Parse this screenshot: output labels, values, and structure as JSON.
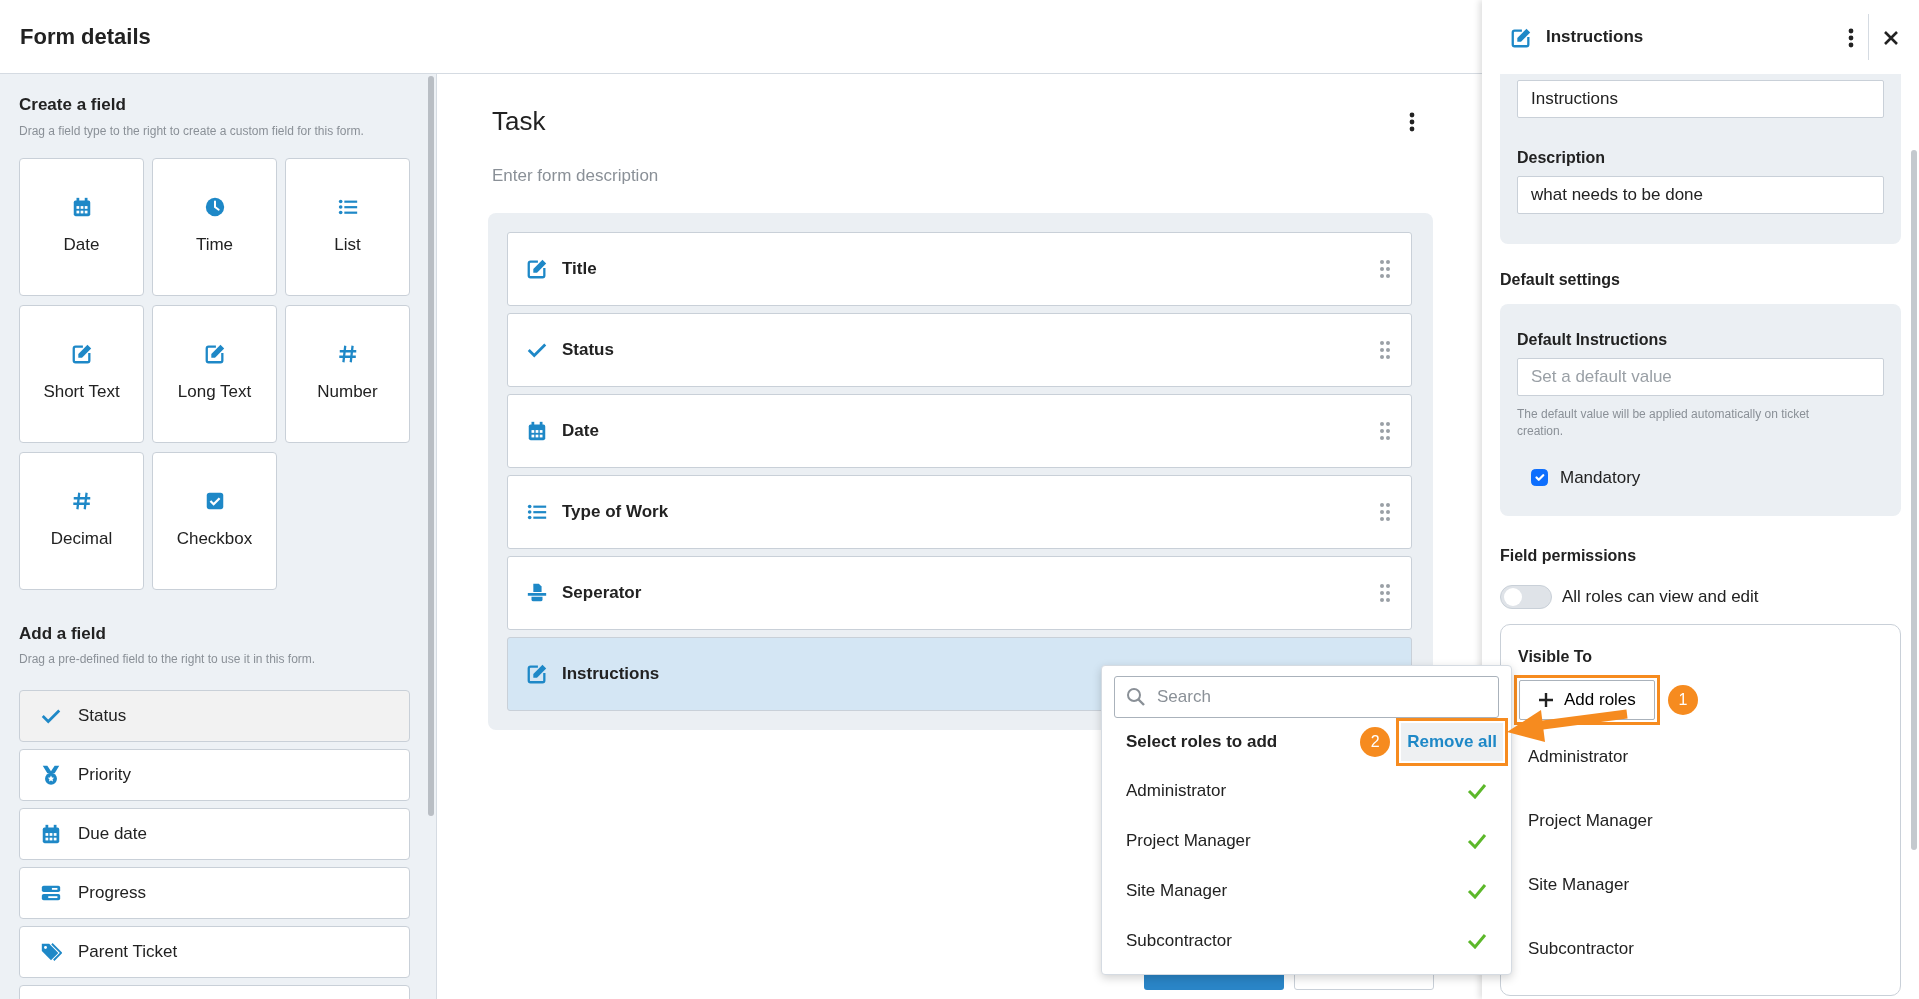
{
  "header": {
    "title": "Form details"
  },
  "create_section": {
    "title": "Create a field",
    "hint": "Drag a field type to the right to create a custom field for this form.",
    "field_types": [
      {
        "label": "Date",
        "kind": "calendar"
      },
      {
        "label": "Time",
        "kind": "clock"
      },
      {
        "label": "List",
        "kind": "list"
      },
      {
        "label": "Short Text",
        "kind": "edit"
      },
      {
        "label": "Long Text",
        "kind": "edit"
      },
      {
        "label": "Number",
        "kind": "hash"
      },
      {
        "label": "Decimal",
        "kind": "hash"
      },
      {
        "label": "Checkbox",
        "kind": "checkbox"
      }
    ]
  },
  "add_section": {
    "title": "Add a field",
    "hint": "Drag a pre-defined field to the right to use it in this form.",
    "fields": [
      {
        "label": "Status",
        "kind": "check",
        "selected": true
      },
      {
        "label": "Priority",
        "kind": "medal",
        "selected": false
      },
      {
        "label": "Due date",
        "kind": "calendar",
        "selected": false
      },
      {
        "label": "Progress",
        "kind": "progress",
        "selected": false
      },
      {
        "label": "Parent Ticket",
        "kind": "tag",
        "selected": false
      },
      {
        "kind": "partial",
        "selected": false
      }
    ]
  },
  "form": {
    "title": "Task",
    "description_placeholder": "Enter form description",
    "fields": [
      {
        "label": "Title",
        "kind": "edit",
        "selected": false
      },
      {
        "label": "Status",
        "kind": "check",
        "selected": false
      },
      {
        "label": "Date",
        "kind": "calendar",
        "selected": false
      },
      {
        "label": "Type of Work",
        "kind": "list",
        "selected": false
      },
      {
        "label": "Seperator",
        "kind": "stamp",
        "selected": false
      },
      {
        "label": "Instructions",
        "kind": "edit",
        "selected": true
      }
    ]
  },
  "role_dropdown": {
    "search_placeholder": "Search",
    "heading": "Select roles to add",
    "remove_all": "Remove all",
    "roles": [
      {
        "label": "Administrator",
        "checked": true
      },
      {
        "label": "Project Manager",
        "checked": true
      },
      {
        "label": "Site Manager",
        "checked": true
      },
      {
        "label": "Subcontractor",
        "checked": true
      }
    ]
  },
  "panel": {
    "title": "Instructions",
    "name_value": "Instructions",
    "description_label": "Description",
    "description_value": "what needs to be done",
    "default_settings_heading": "Default settings",
    "default_label": "Default Instructions",
    "default_placeholder": "Set a default value",
    "default_hint": "The default value will be applied automatically on ticket creation.",
    "mandatory": {
      "label": "Mandatory",
      "checked": true
    },
    "permissions_heading": "Field permissions",
    "all_roles": {
      "label": "All roles can view and edit",
      "on": false
    },
    "visible_heading": "Visible To",
    "add_roles": "Add roles",
    "visible_roles": [
      "Administrator",
      "Project Manager",
      "Site Manager",
      "Subcontractor"
    ]
  },
  "annotations": [
    {
      "number": "1"
    },
    {
      "number": "2"
    }
  ]
}
